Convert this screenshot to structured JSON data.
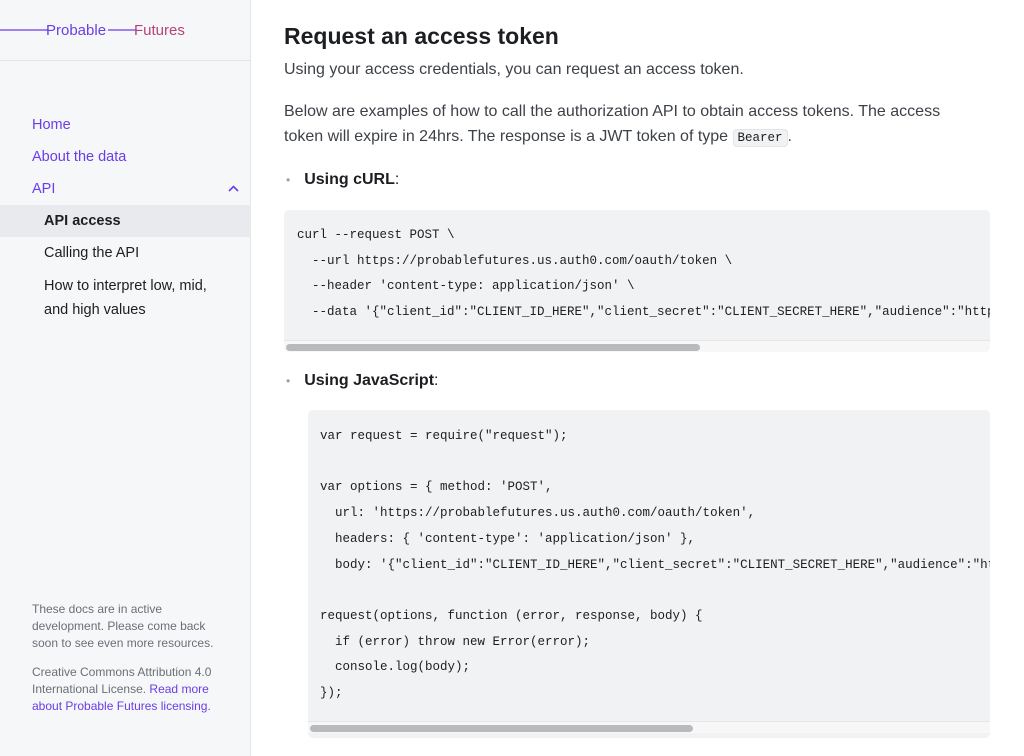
{
  "logo": {
    "word1": "Probable",
    "word2": "Futures"
  },
  "sidebar": {
    "items": [
      {
        "label": "Home"
      },
      {
        "label": "About the data"
      },
      {
        "label": "API"
      }
    ],
    "subitems": [
      {
        "label": "API access"
      },
      {
        "label": "Calling the API"
      },
      {
        "label": "How to interpret low, mid, and high values"
      }
    ],
    "footer": {
      "notice": "These docs are in active development. Please come back soon to see even more resources.",
      "license": "Creative Commons Attribution 4.0 International License.",
      "license_link": "Read more about Probable Futures licensing."
    }
  },
  "main": {
    "title": "Request an access token",
    "lead": "Using your access credentials, you can request an access token.",
    "para_before": "Below are examples of how to call the authorization API to obtain access tokens. The access token will expire in 24hrs. The response is a JWT token of type ",
    "para_code": "Bearer",
    "para_after": ".",
    "curl_heading": "Using cURL",
    "curl_code": "curl --request POST \\\n  --url https://probablefutures.us.auth0.com/oauth/token \\\n  --header 'content-type: application/json' \\\n  --data '{\"client_id\":\"CLIENT_ID_HERE\",\"client_secret\":\"CLIENT_SECRET_HERE\",\"audience\":\"https://graphql.probablefutures.com\",\"grant_type\":\"client_credentials\"}'",
    "js_heading": "Using JavaScript",
    "js_code": "var request = require(\"request\");\n\nvar options = { method: 'POST',\n  url: 'https://probablefutures.us.auth0.com/oauth/token',\n  headers: { 'content-type': 'application/json' },\n  body: '{\"client_id\":\"CLIENT_ID_HERE\",\"client_secret\":\"CLIENT_SECRET_HERE\",\"audience\":\"https://graphql.probablefutures.com\",\"grant_type\":\"client_credentials\"}' };\n\nrequest(options, function (error, response, body) {\n  if (error) throw new Error(error);\n  console.log(body);\n});"
  },
  "colors": {
    "accent": "#6a3de8",
    "logo_accent2": "#c0397a"
  }
}
